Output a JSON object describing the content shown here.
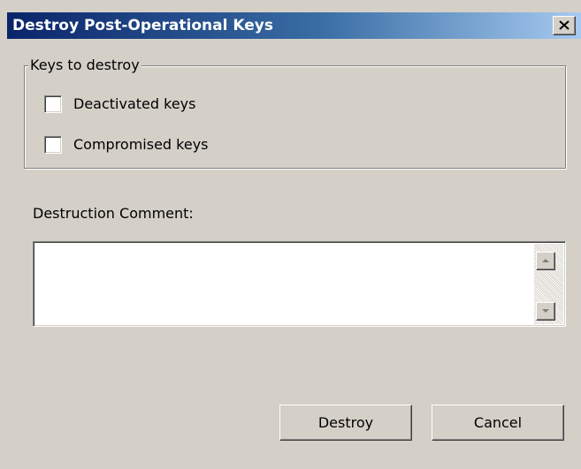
{
  "window": {
    "title": "Destroy Post-Operational Keys",
    "close_icon": "close-icon",
    "titlebar_color_start": "#0a246a",
    "titlebar_color_end": "#a6caf0"
  },
  "group": {
    "legend": "Keys to destroy",
    "options": [
      {
        "label": "Deactivated keys",
        "checked": false
      },
      {
        "label": "Compromised keys",
        "checked": false
      }
    ]
  },
  "comment": {
    "label": "Destruction Comment:",
    "value": ""
  },
  "buttons": {
    "destroy": "Destroy",
    "cancel": "Cancel"
  }
}
